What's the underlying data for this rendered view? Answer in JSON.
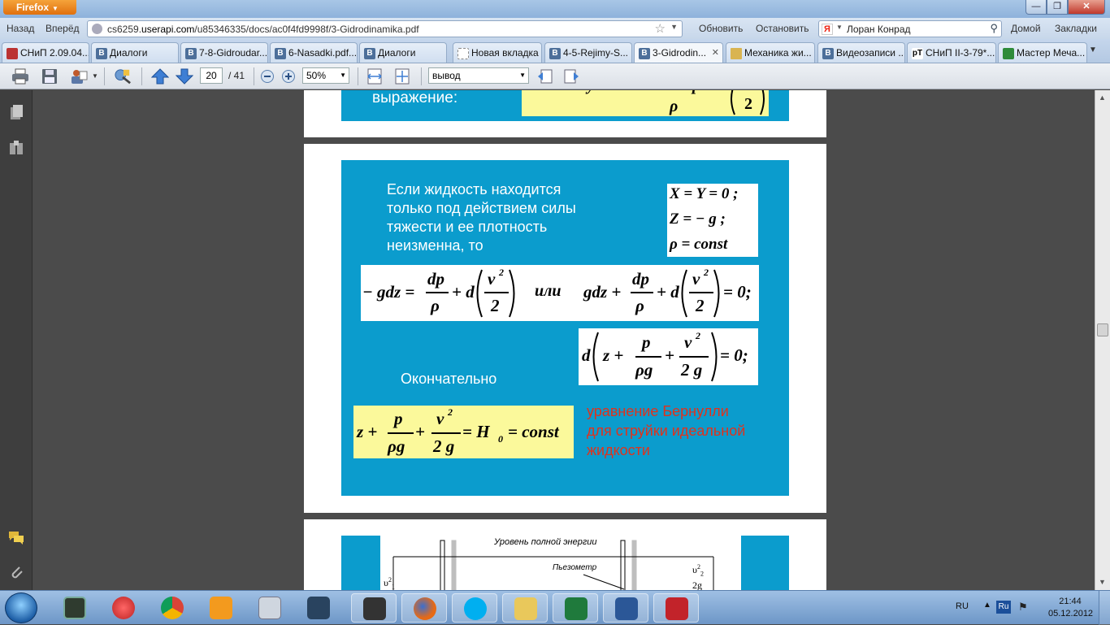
{
  "browser": {
    "menu_label": "Firefox",
    "back_label": "Назад",
    "forward_label": "Вперёд",
    "url_prefix": "cs6259.",
    "url_domain": "userapi.com",
    "url_path": "/u85346335/docs/ac0f4fd9998f/3-Gidrodinamika.pdf",
    "reload_label": "Обновить",
    "stop_label": "Остановить",
    "search_engine_icon": "Я",
    "search_text": "Лоран Конрад",
    "home_label": "Домой",
    "bookmarks_label": "Закладки"
  },
  "tabs": [
    {
      "label": "СНиП 2.09.04...",
      "icon": "snip-icon",
      "glyph": "В"
    },
    {
      "label": "Диалоги",
      "icon": "vk-icon",
      "glyph": "В"
    },
    {
      "label": "7-8-Gidroudar...",
      "icon": "vk-icon",
      "glyph": "В"
    },
    {
      "label": "6-Nasadki.pdf...",
      "icon": "vk-icon",
      "glyph": "В"
    },
    {
      "label": "Диалоги",
      "icon": "vk-icon",
      "glyph": "В"
    },
    {
      "label": "Новая вкладка",
      "icon": "blank-icon",
      "glyph": ""
    },
    {
      "label": "4-5-Rejimy-S...",
      "icon": "vk-icon",
      "glyph": "В"
    },
    {
      "label": "3-Gidrodin...",
      "icon": "vk-icon",
      "glyph": "В"
    },
    {
      "label": "Механика жи...",
      "icon": "folder-icon",
      "glyph": ""
    },
    {
      "label": "Видеозаписи ...",
      "icon": "vk-icon",
      "glyph": "В"
    },
    {
      "label": "СНиП II-3-79*...",
      "icon": "snip-icon",
      "glyph": "рТ"
    },
    {
      "label": "Мастер Меча...",
      "icon": "game-icon",
      "glyph": ""
    }
  ],
  "pdf_toolbar": {
    "page_current": "20",
    "page_total": "/ 41",
    "zoom": "50%",
    "search_value": "вывод"
  },
  "slide_top": {
    "label": "выражение:"
  },
  "slide_main": {
    "intro": [
      "Если жидкость находится",
      "только под действием силы",
      "тяжести и ее плотность",
      "неизменна, то"
    ],
    "cond_1": "X = Y = 0 ;",
    "cond_2": "Z = − g ;",
    "cond_3": "ρ = const",
    "eq_minus_gdz": "− gdz =",
    "frac_dp": "dp",
    "frac_rho": "ρ",
    "plus_d": "+ d",
    "v2": "v",
    "sq": "2",
    "two": "2",
    "ili": "или",
    "gdz_plus": "gdz +",
    "eq_zero": "= 0;",
    "d": "d",
    "z_plus": "z +",
    "p": "p",
    "rho_g": "ρg",
    "plus": "+",
    "two_g": "2 g",
    "finally_label": "Окончательно",
    "bern_lhs": "z +",
    "bern_eq": "= H",
    "bern_sub": "0",
    "bern_const": "= const",
    "red_lines": [
      "уравнение Бернулли",
      "для струйки идеальной",
      "жидкости"
    ]
  },
  "slide_bottom": {
    "diagram_title": "Уровень полной энергии",
    "piezometer": "Пьезометр",
    "v1": "υ",
    "v1_sup": "2",
    "v1_sub": "1",
    "v2_label": "υ",
    "v2_sup": "2",
    "v2_sub": "2",
    "two_g": "2g"
  },
  "taskbar": {
    "lang": "RU",
    "ime": "Ru",
    "time": "21:44",
    "date": "05.12.2012"
  },
  "colors": {
    "slide_blue": "#0b9ccd",
    "formula_yellow": "#fbf99b",
    "bernoulli_red": "#e0321c"
  }
}
